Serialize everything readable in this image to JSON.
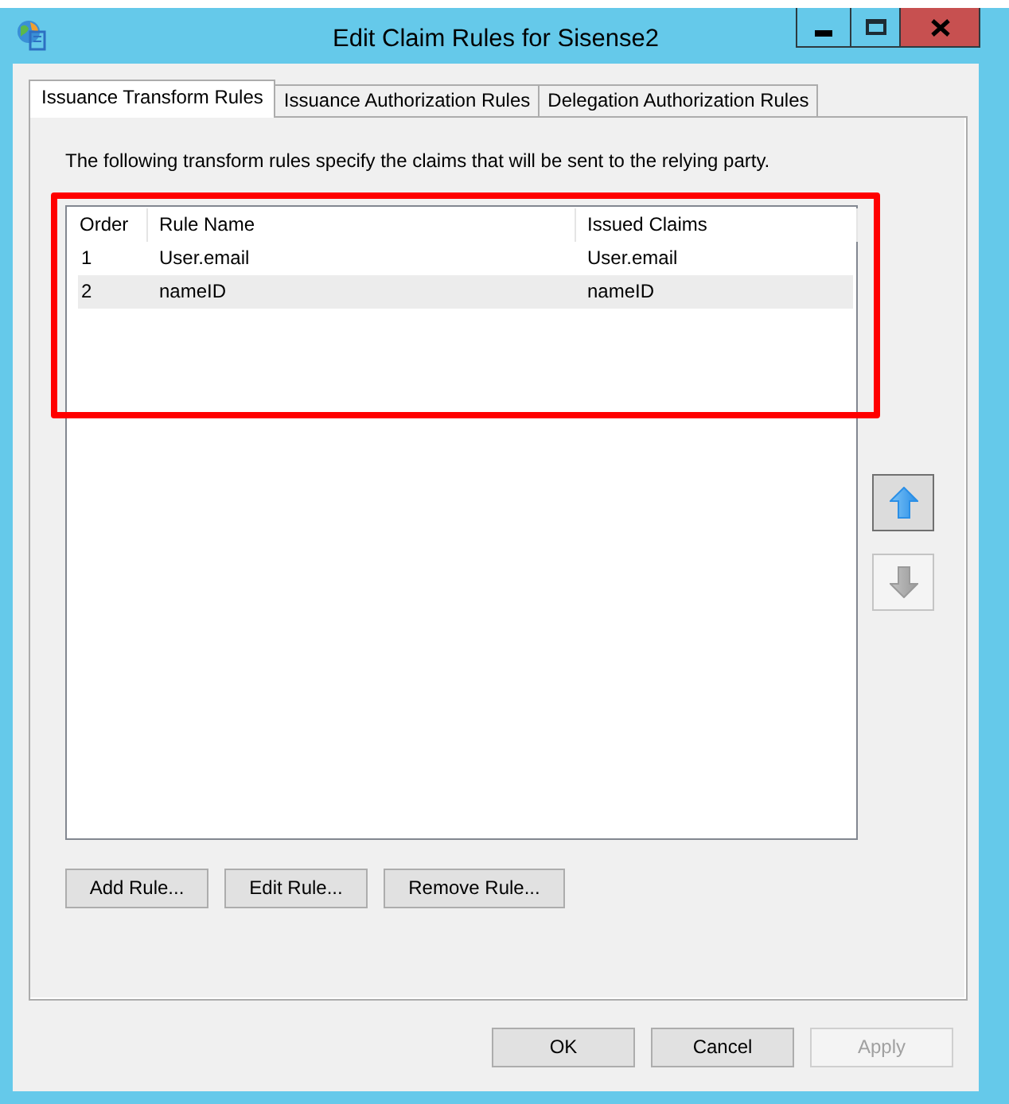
{
  "window": {
    "title": "Edit Claim Rules for Sisense2"
  },
  "tabs": [
    {
      "label": "Issuance Transform Rules",
      "selected": true
    },
    {
      "label": "Issuance Authorization Rules",
      "selected": false
    },
    {
      "label": "Delegation Authorization Rules",
      "selected": false
    }
  ],
  "description": "The following transform rules specify the claims that will be sent to the relying party.",
  "rules_table": {
    "columns": [
      "Order",
      "Rule Name",
      "Issued Claims"
    ],
    "rows": [
      {
        "cells": [
          "1",
          "User.email",
          "User.email"
        ],
        "selected": false
      },
      {
        "cells": [
          "2",
          "nameID",
          "nameID"
        ],
        "selected": true
      }
    ]
  },
  "annotations": [
    {
      "kind": "rectangle"
    }
  ],
  "move_buttons": [
    {
      "kind": "up",
      "disabled": false
    },
    {
      "kind": "down",
      "disabled": true
    }
  ],
  "rule_buttons": [
    "Add Rule...",
    "Edit Rule...",
    "Remove Rule..."
  ],
  "dialog_buttons": [
    {
      "label": "OK",
      "disabled": false
    },
    {
      "label": "Cancel",
      "disabled": false
    },
    {
      "label": "Apply",
      "disabled": true
    }
  ]
}
